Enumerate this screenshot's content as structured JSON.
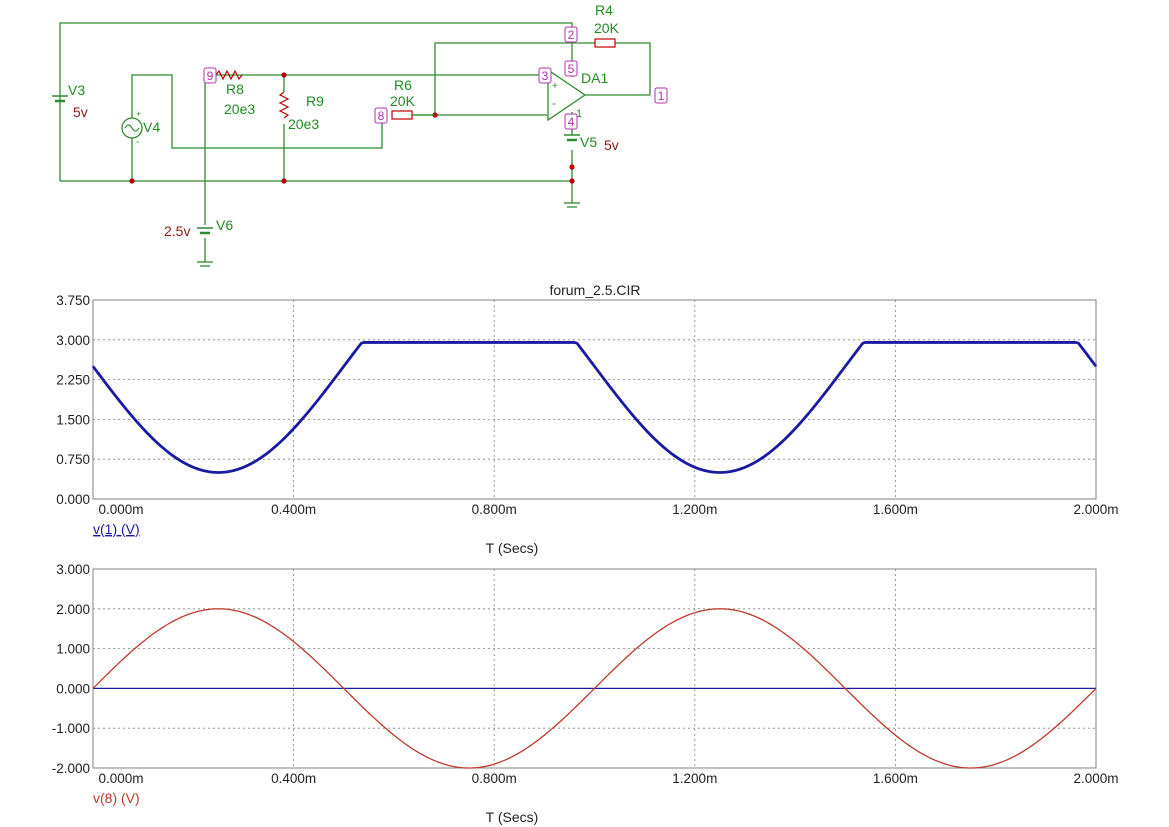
{
  "schematic": {
    "components": {
      "V3": {
        "name": "V3",
        "value": "5v"
      },
      "V4": {
        "name": "V4"
      },
      "V5": {
        "name": "V5",
        "value": "5v"
      },
      "V6": {
        "name": "V6",
        "value": "2.5v"
      },
      "R4": {
        "name": "R4",
        "value": "20K"
      },
      "R6": {
        "name": "R6",
        "value": "20K"
      },
      "R8": {
        "name": "R8",
        "value": "20e3"
      },
      "R9": {
        "name": "R9",
        "value": "20e3"
      },
      "DA1": {
        "name": "DA1",
        "pin_plus": "+",
        "pin_minus": "-",
        "pin_sub": "1"
      }
    },
    "nodes": [
      "1",
      "2",
      "3",
      "4",
      "5",
      "8",
      "9"
    ]
  },
  "colors": {
    "wire": "#2e8b2e",
    "series_v1": "#1a1aa0",
    "series_v8": "#c0392b",
    "zero_line": "#1a1aa0"
  },
  "chart_data": [
    {
      "type": "line",
      "title": "forum_2.5.CIR",
      "xlabel": "T (Secs)",
      "xlim": [
        0,
        2.0
      ],
      "ylim": [
        0,
        3.75
      ],
      "yticks": [
        "0.000",
        "0.750",
        "1.500",
        "2.250",
        "3.000",
        "3.750"
      ],
      "ytick_values": [
        0,
        0.75,
        1.5,
        2.25,
        3.0,
        3.75
      ],
      "xticks": [
        "0.000m",
        "0.400m",
        "0.800m",
        "1.200m",
        "1.600m",
        "2.000m"
      ],
      "xtick_values": [
        0,
        0.4,
        0.8,
        1.2,
        1.6,
        2.0
      ],
      "grid": true,
      "series": [
        {
          "name": "v(1) (V)",
          "color": "#1a1aa0",
          "x": [
            0,
            0.05,
            0.1,
            0.15,
            0.2,
            0.25,
            0.3,
            0.35,
            0.4,
            0.45,
            0.5,
            0.53,
            0.55,
            0.6,
            0.7,
            0.8,
            0.9,
            0.95,
            0.97,
            1.0,
            1.05,
            1.1,
            1.15,
            1.2,
            1.25,
            1.3,
            1.35,
            1.4,
            1.45,
            1.5,
            1.53,
            1.55,
            1.6,
            1.7,
            1.8,
            1.9,
            1.95,
            1.97,
            2.0
          ],
          "y": [
            2.5,
            1.88,
            1.32,
            0.88,
            0.6,
            0.5,
            0.6,
            0.88,
            1.32,
            1.88,
            2.5,
            2.85,
            2.95,
            2.95,
            2.95,
            2.95,
            2.95,
            2.95,
            2.92,
            2.5,
            1.88,
            1.32,
            0.88,
            0.6,
            0.5,
            0.6,
            0.88,
            1.32,
            1.88,
            2.5,
            2.85,
            2.95,
            2.95,
            2.95,
            2.95,
            2.95,
            2.95,
            2.92,
            2.5
          ]
        }
      ]
    },
    {
      "type": "line",
      "title": "",
      "xlabel": "T (Secs)",
      "xlim": [
        0,
        2.0
      ],
      "ylim": [
        -2.0,
        3.0
      ],
      "yticks": [
        "-2.000",
        "-1.000",
        "0.000",
        "1.000",
        "2.000",
        "3.000"
      ],
      "ytick_values": [
        -2.0,
        -1.0,
        0,
        1.0,
        2.0,
        3.0
      ],
      "xticks": [
        "0.000m",
        "0.400m",
        "0.800m",
        "1.200m",
        "1.600m",
        "2.000m"
      ],
      "xtick_values": [
        0,
        0.4,
        0.8,
        1.2,
        1.6,
        2.0
      ],
      "grid": true,
      "series": [
        {
          "name": "v(8) (V)",
          "color": "#c0392b",
          "x": [
            0,
            0.1,
            0.2,
            0.25,
            0.3,
            0.4,
            0.5,
            0.6,
            0.7,
            0.75,
            0.8,
            0.9,
            1.0,
            1.1,
            1.2,
            1.25,
            1.3,
            1.4,
            1.5,
            1.6,
            1.7,
            1.75,
            1.8,
            1.9,
            2.0
          ],
          "y": [
            0,
            1.176,
            1.902,
            2.0,
            1.902,
            1.176,
            0,
            -1.176,
            -1.902,
            -2.0,
            -1.902,
            -1.176,
            0,
            1.176,
            1.902,
            2.0,
            1.902,
            1.176,
            0,
            -1.176,
            -1.902,
            -2.0,
            -1.902,
            -1.176,
            0
          ]
        }
      ]
    }
  ]
}
